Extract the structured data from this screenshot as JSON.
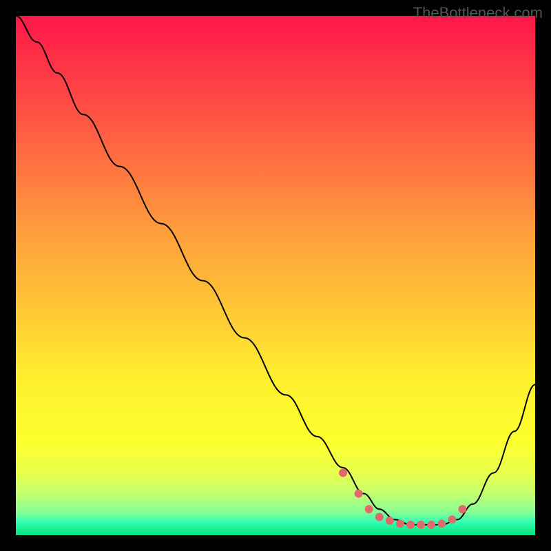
{
  "watermark": "TheBottleneck.com",
  "chart_data": {
    "type": "line",
    "title": "",
    "xlabel": "",
    "ylabel": "",
    "xlim": [
      0,
      100
    ],
    "ylim": [
      0,
      100
    ],
    "background": {
      "type": "vertical-gradient",
      "description": "Red to orange to yellow from top, sharp yellow-green bands near bottom, thin bright green band at very bottom",
      "stops": [
        {
          "pos": 0.0,
          "color": "#ff1749"
        },
        {
          "pos": 0.2,
          "color": "#ff5543"
        },
        {
          "pos": 0.4,
          "color": "#ff993c"
        },
        {
          "pos": 0.58,
          "color": "#ffcb35"
        },
        {
          "pos": 0.7,
          "color": "#fff02f"
        },
        {
          "pos": 0.82,
          "color": "#fdff2c"
        },
        {
          "pos": 0.88,
          "color": "#e8ff4d"
        },
        {
          "pos": 0.92,
          "color": "#c3ff70"
        },
        {
          "pos": 0.955,
          "color": "#88ff94"
        },
        {
          "pos": 0.975,
          "color": "#34ffb4"
        },
        {
          "pos": 1.0,
          "color": "#00e47a"
        }
      ]
    },
    "series": [
      {
        "name": "main-curve",
        "color": "#000000",
        "stroke_width": 2,
        "x": [
          0,
          4,
          8,
          13,
          20,
          28,
          36,
          44,
          52,
          58,
          63,
          67,
          70,
          73,
          76,
          79,
          82,
          85,
          88,
          92,
          96,
          100
        ],
        "y": [
          100,
          95,
          89,
          81,
          71,
          60,
          49,
          38,
          27,
          19,
          13,
          8,
          5,
          3,
          2,
          2,
          2,
          3,
          6,
          12,
          20,
          29
        ]
      },
      {
        "name": "marker-dots",
        "color": "#e06a6a",
        "type": "scatter",
        "marker_radius": 6,
        "x": [
          63,
          66,
          68,
          70,
          72,
          74,
          76,
          78,
          80,
          82,
          84,
          86
        ],
        "y": [
          12,
          8,
          5,
          3.5,
          2.8,
          2.2,
          2,
          2,
          2,
          2.2,
          3,
          5
        ]
      }
    ]
  }
}
